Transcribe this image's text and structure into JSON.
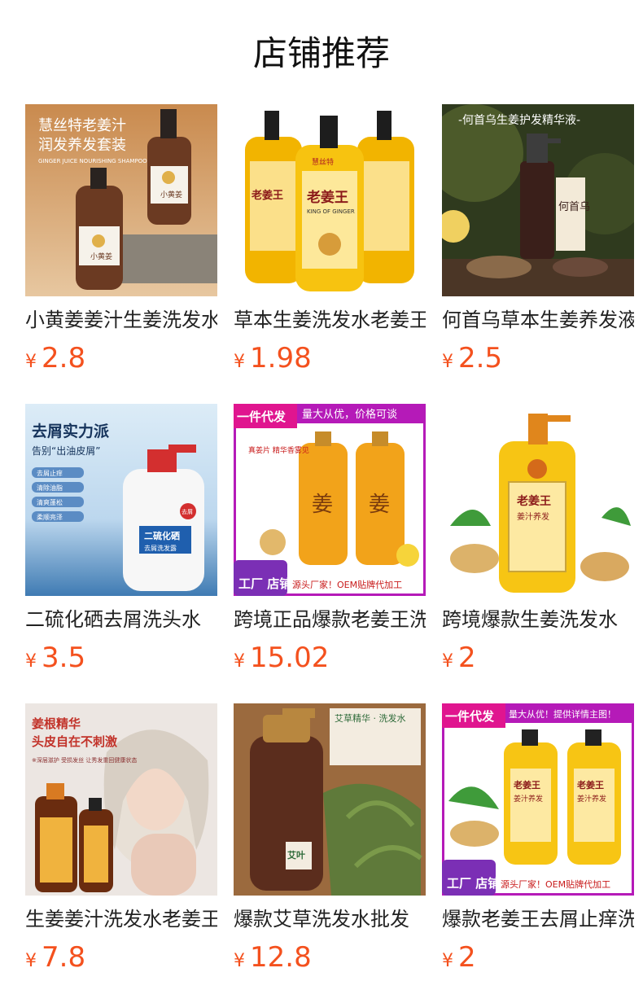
{
  "page_title": "店铺推荐",
  "colors": {
    "price": "#f4511e",
    "title": "#111111",
    "name": "#222222"
  },
  "products": [
    {
      "name": "小黄姜姜汁生姜洗发水",
      "currency": "¥",
      "price": "2.8",
      "image": {
        "top": "慧丝特老姜汁",
        "sub": "润发养发套装",
        "small": "GINGER JUICE NOURISHING SHAMPOO",
        "label": "小黄姜"
      }
    },
    {
      "name": "草本生姜洗发水老姜王",
      "currency": "¥",
      "price": "1.98",
      "image": {
        "brand": "慧丝特",
        "label": "老姜王",
        "small": "KING OF GINGER"
      }
    },
    {
      "name": "何首乌草本生姜养发液",
      "currency": "¥",
      "price": "2.5",
      "image": {
        "top": "-何首乌生姜护发精华液-",
        "label": "何首乌"
      }
    },
    {
      "name": "二硫化硒去屑洗头水",
      "currency": "¥",
      "price": "3.5",
      "image": {
        "top": "去屑实力派",
        "sub": "告别“出油皮屑”",
        "tags": [
          "去屑止痒",
          "清除油脂",
          "清爽蓬松",
          "柔顺亮泽"
        ],
        "label": "二硫化硒",
        "label2": "去屑洗发露",
        "badge": "去屑"
      }
    },
    {
      "name": "跨境正品爆款老姜王洗发水",
      "currency": "¥",
      "price": "15.02",
      "image": {
        "corner": "一件代发",
        "banner": "量大从优，价格可谈",
        "tag": "真姜片 精华香雾见",
        "label": "姜",
        "factory": "工厂 店铺",
        "bottom": "源头厂家！OEM贴牌代加工"
      }
    },
    {
      "name": "跨境爆款生姜洗发水",
      "currency": "¥",
      "price": "2",
      "image": {
        "label": "老姜王",
        "sub": "姜汁养发"
      }
    },
    {
      "name": "生姜姜汁洗发水老姜王",
      "currency": "¥",
      "price": "7.8",
      "image": {
        "top": "姜根精华",
        "sub": "头皮自在不刺激",
        "small": "※深层滋护 受损发丝 让秀发重回健康状态"
      }
    },
    {
      "name": "爆款艾草洗发水批发",
      "currency": "¥",
      "price": "12.8",
      "image": {
        "top": "艾草精华 · 洗发水",
        "label": "艾叶"
      }
    },
    {
      "name": "爆款老姜王去屑止痒洗发水",
      "currency": "¥",
      "price": "2",
      "image": {
        "corner": "一件代发",
        "banner": "量大从优！提供详情主图！",
        "label": "老姜王",
        "sub": "姜汁养发",
        "factory": "工厂 店铺",
        "bottom": "源头厂家！OEM贴牌代加工"
      }
    }
  ]
}
